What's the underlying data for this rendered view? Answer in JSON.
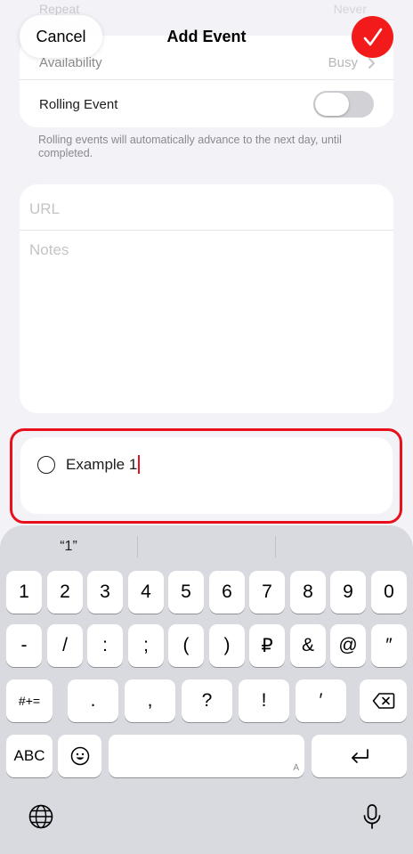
{
  "ghost_row": {
    "label": "Repeat",
    "value": "Never"
  },
  "header": {
    "title": "Add Event",
    "cancel_label": "Cancel"
  },
  "settings": {
    "availability_label": "Availability",
    "availability_value": "Busy",
    "rolling_label": "Rolling Event",
    "rolling_enabled": false,
    "rolling_footnote": "Rolling events will automatically advance to the next day, until completed."
  },
  "notes_card": {
    "url_placeholder": "URL",
    "notes_placeholder": "Notes"
  },
  "subtask": {
    "text": "Example 1"
  },
  "keyboard": {
    "suggestions": [
      "“1”",
      "",
      ""
    ],
    "row1": [
      "1",
      "2",
      "3",
      "4",
      "5",
      "6",
      "7",
      "8",
      "9",
      "0"
    ],
    "row2": [
      "-",
      "/",
      ":",
      ";",
      "(",
      ")",
      "₽",
      "&",
      "@",
      "″"
    ],
    "row3_left": "#+=",
    "row3_punct": [
      ".",
      ",",
      "?",
      "!",
      "′"
    ],
    "abc_label": "ABC",
    "space_hint": "A"
  },
  "colors": {
    "accent": "#f21a1a",
    "highlight": "#e8111b",
    "background": "#f2f2f7",
    "keyboard": "#d8dae0"
  }
}
